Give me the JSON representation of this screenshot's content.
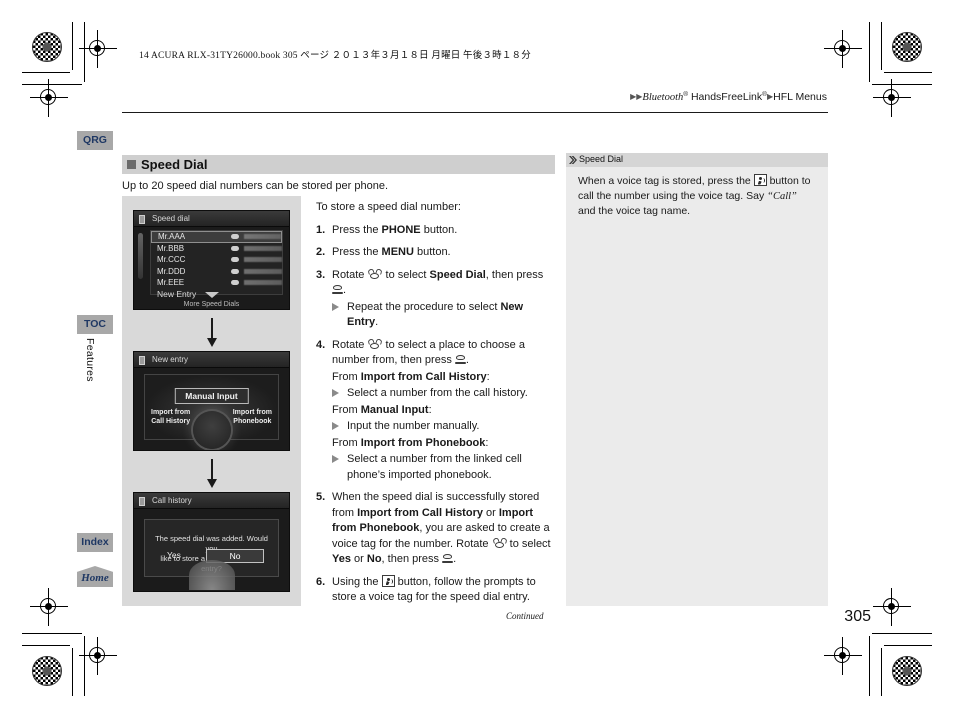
{
  "print_header": "14 ACURA RLX-31TY26000.book   305 ページ   ２０１３年３月１８日   月曜日   午後３時１８分",
  "breadcrumb": {
    "arrow1": "▶▶",
    "item1": "Bluetooth",
    "sup1": "®",
    "item2": " HandsFreeLink",
    "sup2": "®",
    "arrow2": "▶",
    "item3": "HFL Menus"
  },
  "tabs": {
    "qrg": "QRG",
    "toc": "TOC",
    "features": "Features",
    "index": "Index",
    "home": "Home"
  },
  "section": {
    "title": "Speed Dial",
    "lede": "Up to 20 speed dial numbers can be stored per phone."
  },
  "screens": {
    "speed_dial": {
      "title": "Speed dial",
      "rows": [
        {
          "name": "Mr.AAA"
        },
        {
          "name": "Mr.BBB"
        },
        {
          "name": "Mr.CCC"
        },
        {
          "name": "Mr.DDD"
        },
        {
          "name": "Mr.EEE"
        }
      ],
      "new_entry": "New Entry",
      "more": "More Speed Dials"
    },
    "new_entry": {
      "title": "New entry",
      "manual": "Manual Input",
      "left_line1": "Import from",
      "left_line2": "Call History",
      "right_line1": "Import from",
      "right_line2": "Phonebook"
    },
    "call_history": {
      "title": "Call history",
      "message_line1": "The speed dial was added. Would you",
      "message_line2": "like to store a Voice tag for this entry?",
      "yes": "Yes",
      "no": "No"
    }
  },
  "steps": {
    "lead": "To store a speed dial number:",
    "s1": {
      "num": "1.",
      "pre": "Press the ",
      "bold": "PHONE",
      "post": " button."
    },
    "s2": {
      "num": "2.",
      "pre": "Press the ",
      "bold": "MENU",
      "post": " button."
    },
    "s3": {
      "num": "3.",
      "pre": "Rotate ",
      "mid": " to select ",
      "bold": "Speed Dial",
      "post": ", then press ",
      "end": ".",
      "sub_pre": "Repeat the procedure to select ",
      "sub_bold": "New Entry",
      "sub_post": "."
    },
    "s4": {
      "num": "4.",
      "pre": "Rotate ",
      "mid": " to select a place to choose a number from, then press ",
      "end": ".",
      "from1_pre": "From ",
      "from1_bold": "Import from Call History",
      "from1_post": ":",
      "sub1": "Select a number from the call history.",
      "from2_pre": "From ",
      "from2_bold": "Manual Input",
      "from2_post": ":",
      "sub2": "Input the number manually.",
      "from3_pre": "From ",
      "from3_bold": "Import from Phonebook",
      "from3_post": ":",
      "sub3": "Select a number from the linked cell phone’s imported phonebook."
    },
    "s5": {
      "num": "5.",
      "p1": "When the speed dial is successfully stored from ",
      "b1": "Import from Call History",
      "p2": " or ",
      "b2": "Import from Phonebook",
      "p3": ", you are asked to create a voice tag for the number. Rotate ",
      "p4": " to select ",
      "b3": "Yes",
      "p5": " or ",
      "b4": "No",
      "p6": ", then press ",
      "p7": "."
    },
    "s6": {
      "num": "6.",
      "pre": "Using the ",
      "post": " button, follow the prompts to store a voice tag for the speed dial entry."
    }
  },
  "note": {
    "title": "Speed Dial",
    "p1": "When a voice tag is stored, press the ",
    "p2": " button to call the number using the voice tag. Say ",
    "italic": "“Call”",
    "p3": " and the voice tag name."
  },
  "footer": {
    "continued": "Continued",
    "page_number": "305"
  }
}
